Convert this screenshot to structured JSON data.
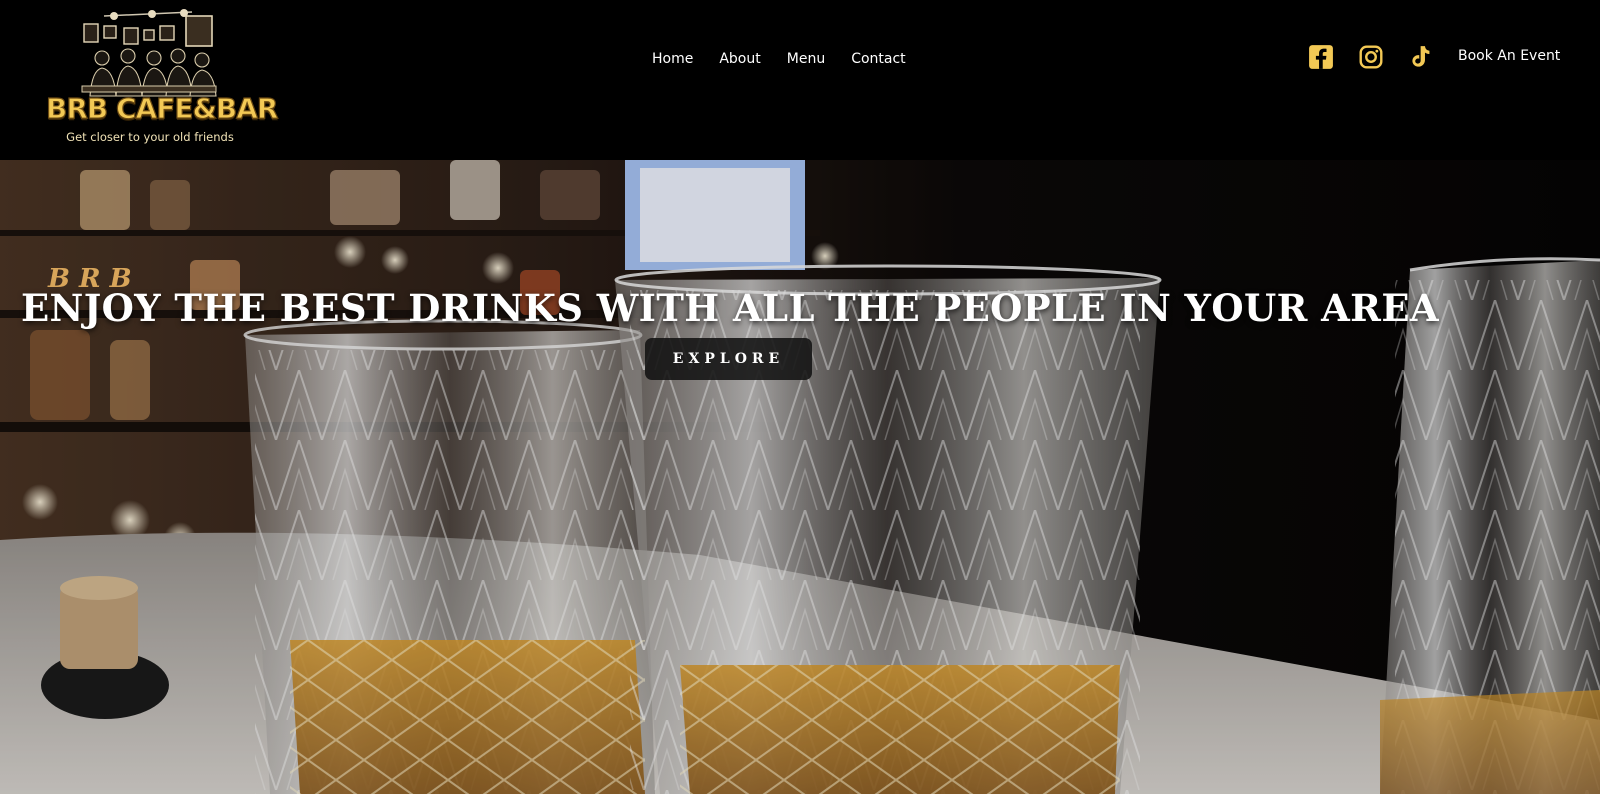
{
  "brand": {
    "logo_text": "BRB CAFE&BAR",
    "tagline": "Get closer to your old friends",
    "accent_color": "#f3c955"
  },
  "nav": {
    "items": [
      {
        "label": "Home"
      },
      {
        "label": "About"
      },
      {
        "label": "Menu"
      },
      {
        "label": "Contact"
      }
    ]
  },
  "social": {
    "icons": [
      "facebook-icon",
      "instagram-icon",
      "tiktok-icon"
    ],
    "icon_color": "#f3c955"
  },
  "cta": {
    "book_label": "Book An Event"
  },
  "hero": {
    "eyebrow": "BRB",
    "headline": "ENJOY THE BEST DRINKS WITH ALL THE PEOPLE IN YOUR AREA",
    "button_label": "EXPLORE",
    "eyebrow_color": "#d8a55a"
  }
}
